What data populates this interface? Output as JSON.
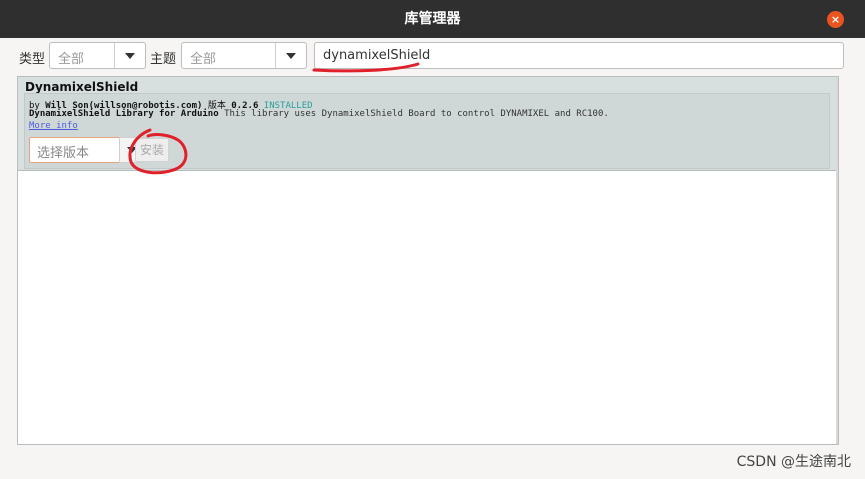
{
  "window": {
    "title": "库管理器",
    "close": "×"
  },
  "filters": {
    "type_label": "类型",
    "type_value": "全部",
    "topic_label": "主题",
    "topic_value": "全部",
    "search_value": "dynamixelShield"
  },
  "library": {
    "name": "DynamixelShield",
    "by_prefix": "by",
    "author": "Will Son(willson@robotis.com)",
    "version_label": "版本",
    "version": "0.2.6",
    "status": "INSTALLED",
    "title": "DynamixelShield Library for Arduino",
    "description": "This library uses DynamixelShield Board to control DYNAMIXEL and RC100.",
    "more_info": "More info",
    "select_version": "选择版本",
    "install": "安装"
  },
  "watermark": "CSDN @生途南北",
  "colors": {
    "accent": "#e95420",
    "installed": "#2a9d9d",
    "link": "#4b5de0",
    "annotation": "#e0202a"
  }
}
